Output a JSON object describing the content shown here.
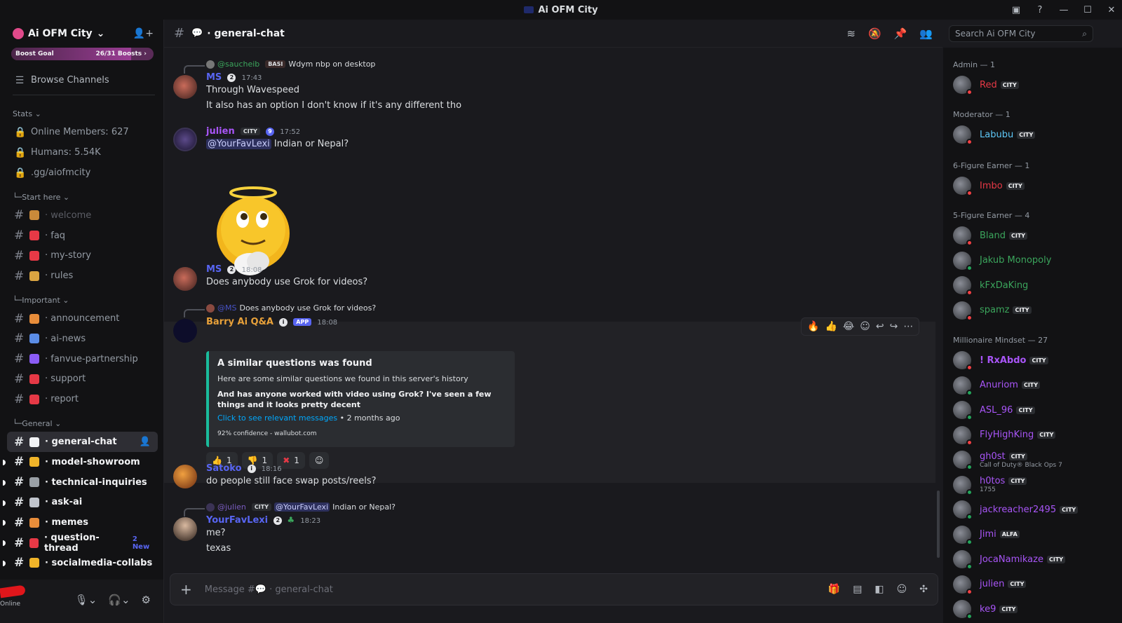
{
  "window": {
    "title": "Ai OFM City"
  },
  "server": {
    "name": "Ai OFM City",
    "boost_label": "Boost Goal",
    "boost_count": "26/31 Boosts",
    "boost_progress": 0.84,
    "browse_channels": "Browse Channels",
    "stats_label": "Stats",
    "stats": [
      "Online Members: 627",
      "Humans: 5.54K",
      ".gg/aiofmcity"
    ]
  },
  "categories": [
    {
      "label": "Start here",
      "channels": [
        {
          "name": "· welcome",
          "emoji_color": "#c98a3a",
          "state": "muted"
        },
        {
          "name": "· faq",
          "emoji_color": "#e63946",
          "state": "normal"
        },
        {
          "name": "· my-story",
          "emoji_color": "#e63946",
          "state": "normal"
        },
        {
          "name": "· rules",
          "emoji_color": "#d9a441",
          "state": "normal"
        }
      ]
    },
    {
      "label": "Important",
      "channels": [
        {
          "name": "· announcement",
          "emoji_color": "#e88d3a",
          "state": "normal"
        },
        {
          "name": "· ai-news",
          "emoji_color": "#5b8de6",
          "state": "normal"
        },
        {
          "name": "· fanvue-partnership",
          "emoji_color": "#8b5cf6",
          "state": "normal"
        },
        {
          "name": "· support",
          "emoji_color": "#e63946",
          "state": "normal"
        },
        {
          "name": "· report",
          "emoji_color": "#e63946",
          "state": "normal"
        }
      ]
    },
    {
      "label": "General",
      "channels": [
        {
          "name": "· general-chat",
          "emoji_color": "#f2f3f5",
          "state": "active"
        },
        {
          "name": "· model-showroom",
          "emoji_color": "#f0b429",
          "state": "unread"
        },
        {
          "name": "· technical-inquiries",
          "emoji_color": "#9aa0a6",
          "state": "unread"
        },
        {
          "name": "· ask-ai",
          "emoji_color": "#c0c4cc",
          "state": "unread"
        },
        {
          "name": "· memes",
          "emoji_color": "#e88d3a",
          "state": "unread"
        },
        {
          "name": "· question-thread",
          "emoji_color": "#e63946",
          "state": "unread",
          "badge": "2 New"
        },
        {
          "name": "· socialmedia-collabs",
          "emoji_color": "#f0b429",
          "state": "unread"
        }
      ]
    }
  ],
  "user": {
    "status": "Online"
  },
  "channel": {
    "name": "general-chat",
    "placeholder": "Message #💬 · general-chat"
  },
  "search": {
    "placeholder": "Search Ai OFM City"
  },
  "messages": {
    "m1": {
      "reply_user": "@saucheib",
      "reply_tag": "BASI",
      "reply_text": "Wdym nbp on desktop",
      "user": "MS",
      "time": "17:43",
      "lines": [
        "Through Wavespeed",
        "It also has an option I don't know if it's any different tho"
      ]
    },
    "m2": {
      "user": "julien",
      "tag": "CITY",
      "time": "17:52",
      "mention": "@YourFavLexi",
      "text": " Indian or Nepal?"
    },
    "m3": {
      "user": "MS",
      "time": "18:08",
      "text": "Does anybody use Grok for videos?"
    },
    "m4": {
      "reply_user": "@MS",
      "reply_text": "Does anybody use Grok for videos?",
      "user": "Barry Ai Q&A",
      "app_tag": "APP",
      "time": "18:08",
      "embed_title": "A similar questions was found",
      "embed_desc": "Here are some similar questions we found in this server's history",
      "embed_q": "And has anyone worked with video using Grok? I've seen a few things and it looks pretty decent",
      "embed_link": "Click to see relevant messages",
      "embed_ago": " • 2 months ago",
      "embed_footer": "92% confidence - wallubot.com",
      "reactions": [
        {
          "icon": "thumbs-up",
          "glyph": "👍",
          "count": "1"
        },
        {
          "icon": "thumbs-down",
          "glyph": "👎",
          "count": "1"
        },
        {
          "icon": "cross-mark",
          "glyph": "✖",
          "count": "1"
        }
      ]
    },
    "m5": {
      "user": "Satoko",
      "time": "18:16",
      "text": "do people still face swap posts/reels?"
    },
    "m6": {
      "reply_user": "@julien",
      "reply_tag": "CITY",
      "reply_mention": "@YourFavLexi",
      "reply_text": " Indian or Nepal?",
      "user": "YourFavLexi",
      "time": "18:23",
      "lines": [
        "me?",
        "texas"
      ]
    }
  },
  "members": {
    "roles": [
      {
        "label": "Admin — 1"
      },
      {
        "label": "Moderator — 1"
      },
      {
        "label": "6-Figure Earner — 1"
      },
      {
        "label": "5-Figure Earner — 4"
      },
      {
        "label": "Millionaire Mindset — 27"
      }
    ],
    "list": [
      {
        "name": "Red",
        "color": "#e63946",
        "tag": "CITY",
        "status": "dnd"
      },
      {
        "name": "Labubu",
        "color": "#5ec8f8",
        "tag": "CITY",
        "status": "dnd"
      },
      {
        "name": "Imbo",
        "color": "#e63946",
        "tag": "CITY",
        "status": "dnd"
      },
      {
        "name": "Bland",
        "color": "#3ba55c",
        "tag": "CITY",
        "status": "dnd"
      },
      {
        "name": "Jakub Monopoly",
        "color": "#3ba55c",
        "tag": "",
        "status": "online"
      },
      {
        "name": "kFxDaKing",
        "color": "#3ba55c",
        "tag": "",
        "status": "dnd"
      },
      {
        "name": "spamz",
        "color": "#3ba55c",
        "tag": "CITY",
        "status": "dnd"
      },
      {
        "name": "! RxAbdo",
        "color": "#a855f7",
        "tag": "CITY",
        "status": "dnd"
      },
      {
        "name": "Anuriom",
        "color": "#a855f7",
        "tag": "CITY",
        "status": "online"
      },
      {
        "name": "ASL_96",
        "color": "#a855f7",
        "tag": "CITY",
        "status": "online"
      },
      {
        "name": "FlyHighKing",
        "color": "#a855f7",
        "tag": "CITY",
        "status": "dnd"
      },
      {
        "name": "gh0st",
        "color": "#a855f7",
        "tag": "CITY",
        "status": "online",
        "sub": "Call of Duty® Black Ops 7"
      },
      {
        "name": "h0tos",
        "color": "#a855f7",
        "tag": "CITY",
        "status": "online",
        "sub": "1755"
      },
      {
        "name": "jackreacher2495",
        "color": "#a855f7",
        "tag": "CITY",
        "status": "online"
      },
      {
        "name": "Jimi",
        "color": "#a855f7",
        "tag": "ALFA",
        "status": "online"
      },
      {
        "name": "JocaNamikaze",
        "color": "#a855f7",
        "tag": "CITY",
        "status": "online"
      },
      {
        "name": "julien",
        "color": "#a855f7",
        "tag": "CITY",
        "status": "dnd"
      },
      {
        "name": "ke9",
        "color": "#a855f7",
        "tag": "CITY",
        "status": "online"
      }
    ]
  },
  "colors": {
    "accent": "#5865f2",
    "embed_bar": "#1abc9c",
    "online": "#23a55a",
    "dnd": "#f23f43"
  }
}
